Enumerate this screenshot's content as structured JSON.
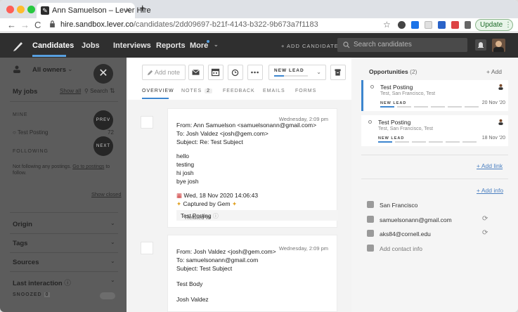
{
  "browser": {
    "tab_title": "Ann Samuelson – Lever Hire",
    "tab_close": "×",
    "new_tab": "+",
    "url_host": "hire.sandbox.lever.co",
    "url_path": "/candidates/2dd09697-b21f-4143-b322-9b673a7f1183",
    "update_label": "Update",
    "back": "←",
    "forward": "→",
    "reload": "C",
    "star": "☆"
  },
  "nav": {
    "items": [
      "Candidates",
      "Jobs",
      "Interviews",
      "Reports",
      "More"
    ],
    "add_candidate": "+ ADD CANDIDATE",
    "search_placeholder": "Search candidates"
  },
  "sidebar": {
    "owners": "All owners",
    "my_jobs": "My jobs",
    "show_all": "Show all",
    "search": "Search",
    "mine": "MINE",
    "posting": "Test Posting",
    "posting_count": "72",
    "following": "FOLLOWING",
    "not_following": "Not following any postings.",
    "go_to_postings": "Go to postings",
    "not_following_tail": "to",
    "follow": "follow.",
    "show_closed": "Show closed",
    "prev": "PREV",
    "next": "NEXT",
    "filters": [
      "Origin",
      "Tags",
      "Sources",
      "Last interaction"
    ],
    "snoozed": "SNOOZED",
    "snoozed_count": "0"
  },
  "actions": {
    "add_note": "Add note",
    "stage": "NEW LEAD"
  },
  "tabs": {
    "overview": "OVERVIEW",
    "notes": "NOTES",
    "notes_count": "2",
    "feedback": "FEEDBACK",
    "emails": "EMAILS",
    "forms": "FORMS"
  },
  "emails": [
    {
      "date": "Wednesday, 2:09 pm",
      "from": "From: Ann Samuelson <samuelsonann@gmail.com>",
      "to": "To: Josh Valdez <josh@gem.com>",
      "subject": "Subject: Re: Test Subject",
      "body": [
        "hello",
        "testing",
        "hi josh",
        "bye josh"
      ],
      "sent": "Wed, 18 Nov 2020 14:06:43",
      "captured": "Captured by Gem",
      "related_prefix": "Related to",
      "related_posting": "Test Posting"
    },
    {
      "date": "Wednesday, 2:09 pm",
      "from": "From: Josh Valdez <josh@gem.com>",
      "to": "To: samuelsonann@gmail.com",
      "subject": "Subject: Test Subject",
      "body": [
        "Test Body",
        "Josh Valdez"
      ]
    }
  ],
  "right": {
    "opportunities": "Opportunities",
    "opp_count": "(2)",
    "add": "+ Add",
    "opps": [
      {
        "title": "Test Posting",
        "location": "Test, San Francisco, Test",
        "stage": "NEW LEAD",
        "date": "20 Nov '20"
      },
      {
        "title": "Test Posting",
        "location": "Test, San Francisco, Test",
        "stage": "NEW LEAD",
        "date": "18 Nov '20"
      }
    ],
    "add_link": "+ Add link",
    "add_info": "+ Add info",
    "location": "San Francisco",
    "email1": "samuelsonann@gmail.com",
    "email2": "aks84@cornell.edu",
    "add_contact": "Add contact info"
  },
  "colors": {
    "accent": "#3d86cf",
    "nav_bg": "#2f2f2f",
    "overlay": "#5c5c5c"
  }
}
